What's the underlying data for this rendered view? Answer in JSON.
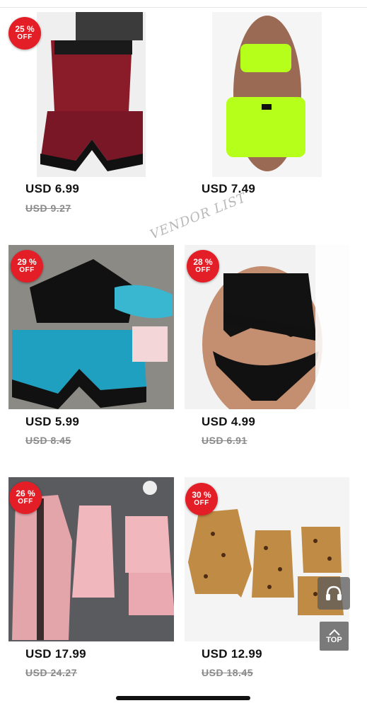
{
  "watermark": "VENDOR LIST",
  "top_button": {
    "label": "TOP"
  },
  "products": [
    {
      "discount": "25 %",
      "off": "OFF",
      "price": "USD 6.99",
      "original": "USD 9.27",
      "image": "red-satin-lace-romper-image"
    },
    {
      "discount": "",
      "off": "",
      "price": "USD 7.49",
      "original": "",
      "image": "neon-green-bra-shorts-set-image"
    },
    {
      "discount": "29 %",
      "off": "OFF",
      "price": "USD 5.99",
      "original": "USD 8.45",
      "image": "black-lace-teal-satin-set-image"
    },
    {
      "discount": "28 %",
      "off": "OFF",
      "price": "USD 4.99",
      "original": "USD 6.91",
      "image": "sexy-baby-bra-set-image"
    },
    {
      "discount": "26 %",
      "off": "OFF",
      "price": "USD 17.99",
      "original": "USD 24.27",
      "image": "pink-satin-four-piece-set-image"
    },
    {
      "discount": "30 %",
      "off": "OFF",
      "price": "USD 12.99",
      "original": "USD 18.45",
      "image": "leopard-four-piece-set-image"
    }
  ]
}
